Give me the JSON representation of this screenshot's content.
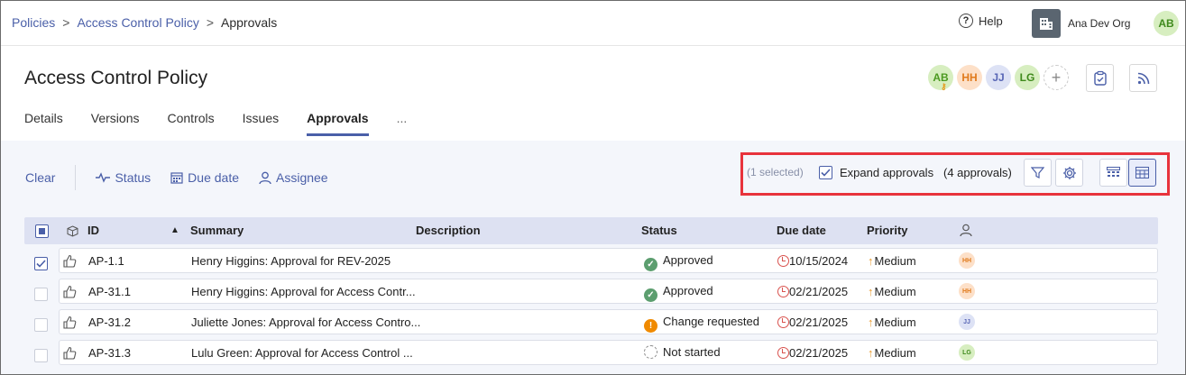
{
  "breadcrumb": {
    "items": [
      "Policies",
      "Access Control Policy",
      "Approvals"
    ],
    "separator": ">"
  },
  "header": {
    "help_label": "Help",
    "org_name": "Ana Dev Org",
    "user_initials": "AB",
    "page_title": "Access Control Policy",
    "participants": [
      "AB",
      "HH",
      "JJ",
      "LG"
    ],
    "add_label": "+"
  },
  "tabs": [
    {
      "label": "Details"
    },
    {
      "label": "Versions"
    },
    {
      "label": "Controls"
    },
    {
      "label": "Issues"
    },
    {
      "label": "Approvals",
      "active": true
    },
    {
      "label": "..."
    }
  ],
  "toolbar": {
    "clear_label": "Clear",
    "filters": [
      "Status",
      "Due date",
      "Assignee"
    ],
    "selected_text": "(1 selected)",
    "expand_label": "Expand approvals",
    "expand_checked": true,
    "approvals_count": "(4 approvals)"
  },
  "table": {
    "columns": [
      "ID",
      "Summary",
      "Description",
      "Status",
      "Due date",
      "Priority"
    ],
    "sort_indicator": "▲",
    "rows": [
      {
        "checked": true,
        "id": "AP-1.1",
        "summary": "Henry Higgins: Approval for REV-2025",
        "description": "",
        "status": "Approved",
        "status_type": "approved",
        "due": "10/15/2024",
        "priority": "Medium",
        "assignee": "HH"
      },
      {
        "checked": false,
        "id": "AP-31.1",
        "summary": "Henry Higgins: Approval for Access Contr...",
        "description": "",
        "status": "Approved",
        "status_type": "approved",
        "due": "02/21/2025",
        "priority": "Medium",
        "assignee": "HH"
      },
      {
        "checked": false,
        "id": "AP-31.2",
        "summary": "Juliette Jones: Approval for Access Contro...",
        "description": "",
        "status": "Change requested",
        "status_type": "change",
        "due": "02/21/2025",
        "priority": "Medium",
        "assignee": "JJ"
      },
      {
        "checked": false,
        "id": "AP-31.3",
        "summary": "Lulu Green: Approval for Access Control ...",
        "description": "",
        "status": "Not started",
        "status_type": "not",
        "due": "02/21/2025",
        "priority": "Medium",
        "assignee": "LG"
      }
    ]
  },
  "colors": {
    "accent": "#4a5fa8",
    "highlight": "#e8333c",
    "approved": "#5c9e6f",
    "change_requested": "#f08a00",
    "overdue_clock": "#d9534f"
  }
}
